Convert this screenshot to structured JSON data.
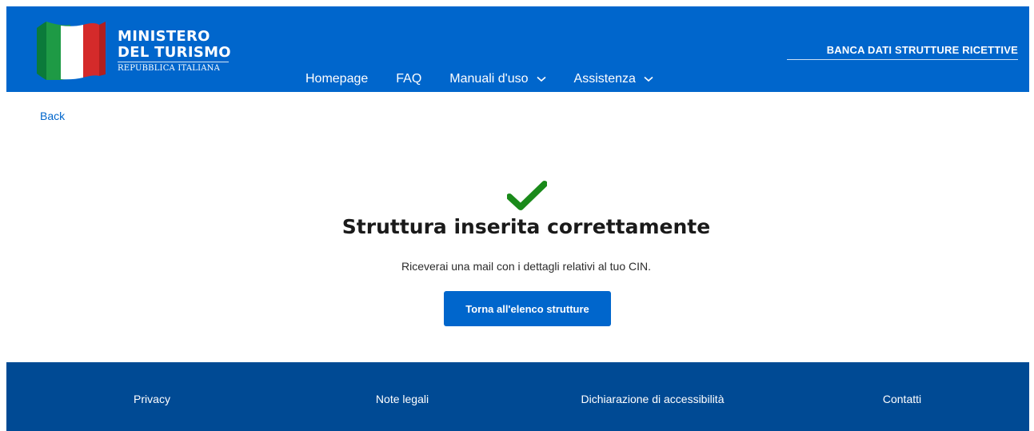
{
  "header": {
    "brand_line1": "MINISTERO",
    "brand_line2": "DEL TURISMO",
    "brand_sub": "REPUBBLICA ITALIANA",
    "database_title": "BANCA DATI STRUTTURE RICETTIVE",
    "colors": {
      "bar": "#0066cc"
    },
    "nav": [
      {
        "label": "Homepage",
        "icon": null
      },
      {
        "label": "FAQ",
        "icon": null
      },
      {
        "label": "Manuali d'uso",
        "icon": "chevron-down-icon"
      },
      {
        "label": "Assistenza",
        "icon": "chevron-down-icon"
      }
    ]
  },
  "back_label": "Back",
  "confirmation": {
    "icon": "checkmark-icon",
    "title": "Struttura inserita correttamente",
    "message": "Riceverai una mail con i dettagli relativi al tuo CIN.",
    "button_label": "Torna all'elenco strutture",
    "colors": {
      "check": "#1a8a1a",
      "button": "#0066cc"
    }
  },
  "footer": {
    "links": [
      "Privacy",
      "Note legali",
      "Dichiarazione di accessibilità",
      "Contatti"
    ],
    "colors": {
      "background": "#004a94"
    }
  }
}
